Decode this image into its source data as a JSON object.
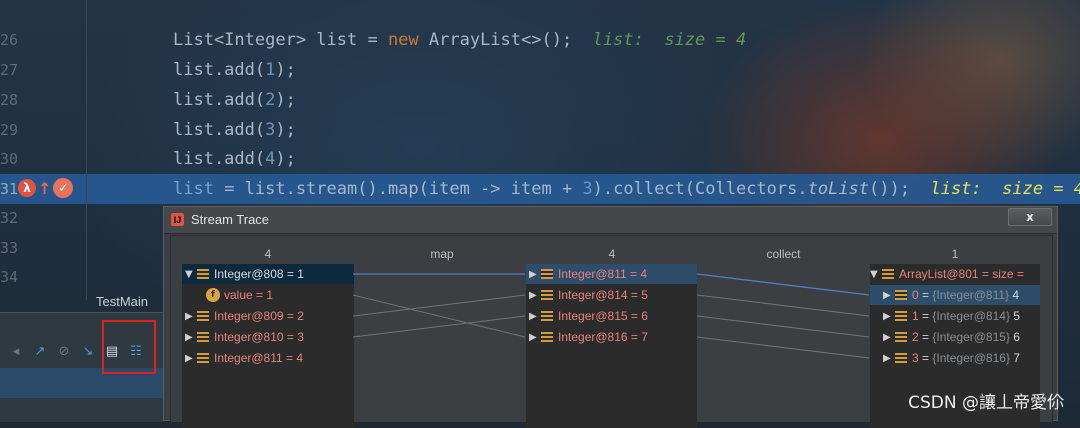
{
  "editor": {
    "line_numbers": [
      "26",
      "27",
      "28",
      "29",
      "30",
      "31",
      "32",
      "33",
      "34"
    ],
    "lines": {
      "l26": {
        "type": "List<Integer> list = ",
        "kw": "new",
        "rest": " ArrayList<>();",
        "hint": "list:  size = 4"
      },
      "l27": {
        "pre": "list.add(",
        "num": "1",
        "post": ");"
      },
      "l28": {
        "pre": "list.add(",
        "num": "2",
        "post": ");"
      },
      "l29": {
        "pre": "list.add(",
        "num": "3",
        "post": ");"
      },
      "l30": {
        "pre": "list.add(",
        "num": "4",
        "post": ");"
      },
      "l31": {
        "var": "list",
        "mid": " = list.stream().map(item -> item + ",
        "num": "3",
        "post": ").collect(Collectors.",
        "method": "toList",
        "end": "());",
        "hint": "list:  size = 4"
      }
    },
    "selection_color": "#265992"
  },
  "debug_panel": {
    "tab_label": "TestMain"
  },
  "dialog": {
    "title": "Stream Trace",
    "close_label": "x",
    "headers": {
      "col1_count": "4",
      "op1": "map",
      "col2_count": "4",
      "op2": "collect",
      "col3_count": "1"
    },
    "source_items": [
      {
        "label": "Integer@808 = 1"
      },
      {
        "field": "value = 1"
      },
      {
        "label": "Integer@809 = 2"
      },
      {
        "label": "Integer@810 = 3"
      },
      {
        "label": "Integer@811 = 4"
      }
    ],
    "mapped_items": [
      {
        "label": "Integer@811 = 4"
      },
      {
        "label": "Integer@814 = 5"
      },
      {
        "label": "Integer@815 = 6"
      },
      {
        "label": "Integer@816 = 7"
      }
    ],
    "result": {
      "root_label": "ArrayList@801 =  size =",
      "items": [
        {
          "key": "0",
          "ref": "{Integer@811}",
          "val": "4"
        },
        {
          "key": "1",
          "ref": "{Integer@814}",
          "val": "5"
        },
        {
          "key": "2",
          "ref": "{Integer@815}",
          "val": "6"
        },
        {
          "key": "3",
          "ref": "{Integer@816}",
          "val": "7"
        }
      ]
    }
  },
  "watermark": "CSDN @讓丄帝愛伱"
}
